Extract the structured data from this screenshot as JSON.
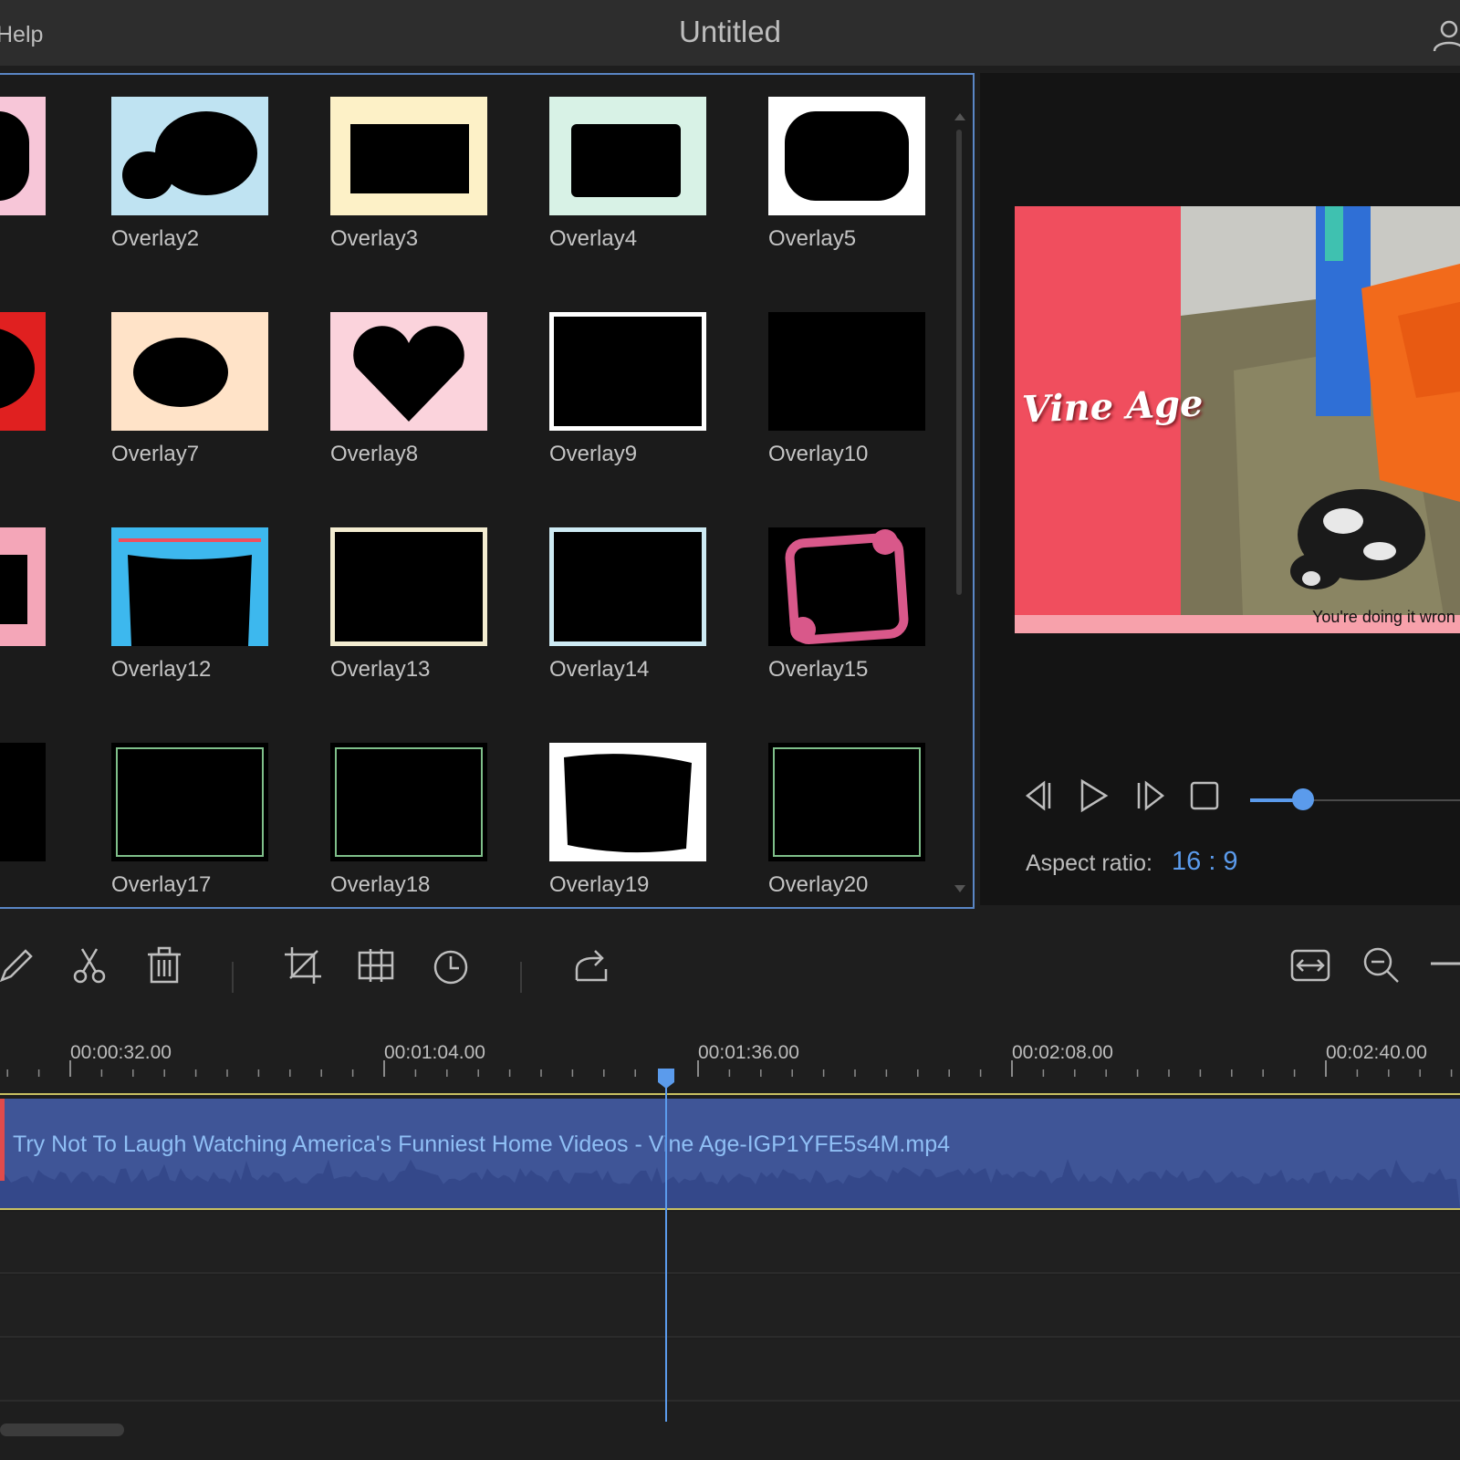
{
  "menu": {
    "help": "Help"
  },
  "window": {
    "title": "Untitled"
  },
  "overlays": [
    {
      "label": "",
      "bg": "#f7c6d8",
      "col": 0,
      "row": 0,
      "partial": true
    },
    {
      "label": "Overlay2",
      "bg": "#bfe3f2"
    },
    {
      "label": "Overlay3",
      "bg": "#fdf1c7"
    },
    {
      "label": "Overlay4",
      "bg": "#d8f2e6"
    },
    {
      "label": "Overlay5",
      "bg": "#ffffff"
    },
    {
      "label": "",
      "bg": "#e02020",
      "partial": true
    },
    {
      "label": "Overlay7",
      "bg": "#ffe3c8"
    },
    {
      "label": "Overlay8",
      "bg": "#fbd3dc"
    },
    {
      "label": "Overlay9",
      "bg": "#ffffff"
    },
    {
      "label": "Overlay10",
      "bg": "#000000"
    },
    {
      "label": "",
      "bg": "#f4a6b8",
      "partial": true
    },
    {
      "label": "Overlay12",
      "bg": "#3db8ee"
    },
    {
      "label": "Overlay13",
      "bg": "#f3ecd0"
    },
    {
      "label": "Overlay14",
      "bg": "#cdeaf3"
    },
    {
      "label": "Overlay15",
      "bg": "#000000"
    },
    {
      "label": "",
      "bg": "#000000",
      "partial": true
    },
    {
      "label": "Overlay17",
      "bg": "#000000"
    },
    {
      "label": "Overlay18",
      "bg": "#000000"
    },
    {
      "label": "Overlay19",
      "bg": "#ffffff"
    },
    {
      "label": "Overlay20",
      "bg": "#000000"
    }
  ],
  "preview": {
    "brand_text": "Vine Age",
    "subtitle": "You're doing it wron",
    "aspect_label": "Aspect ratio:",
    "aspect_value": "16 : 9",
    "volume_fraction": 0.3
  },
  "toolbar": {
    "icons": [
      "pencil-icon",
      "scissors-icon",
      "trash-icon",
      "crop-icon",
      "mosaic-icon",
      "clock-icon",
      "redo-icon",
      "fit-width-icon",
      "zoom-out-icon",
      "minus-icon"
    ]
  },
  "timeline": {
    "ticks": [
      "00:00:32.00",
      "00:01:04.00",
      "00:01:36.00",
      "00:02:08.00",
      "00:02:40.00"
    ],
    "clip_title": "Try Not To Laugh Watching America's Funniest Home Videos - Vine Age-IGP1YFE5s4M.mp4",
    "playhead_time": "00:01:28.00"
  },
  "colors": {
    "accent": "#5b9bec",
    "clip": "#3f5597",
    "border": "#5a86c5"
  }
}
